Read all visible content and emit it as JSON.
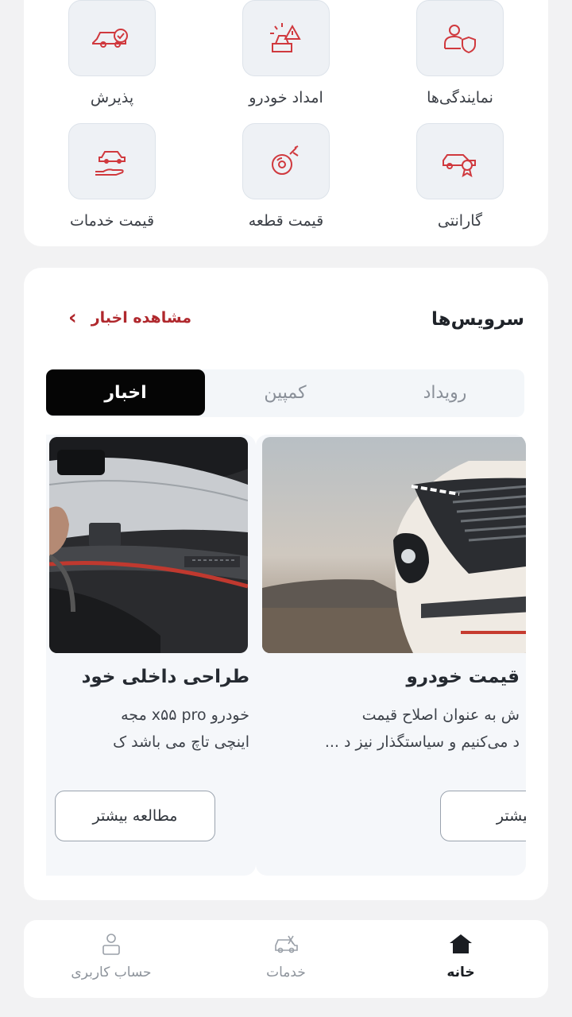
{
  "services": [
    {
      "label": "پذیرش",
      "icon": "car-check-icon"
    },
    {
      "label": "امداد خودرو",
      "icon": "roadside-assist-icon"
    },
    {
      "label": "نمایندگی‌ها",
      "icon": "dealer-shield-icon"
    },
    {
      "label": "قیمت خدمات",
      "icon": "car-hand-icon"
    },
    {
      "label": "قیمت قطعه",
      "icon": "brake-disc-icon"
    },
    {
      "label": "گارانتی",
      "icon": "car-warranty-icon"
    }
  ],
  "news_section": {
    "title": "سرویس‌ها",
    "see_all_label": "مشاهده اخبار",
    "tabs": [
      "رویداد",
      "کمپین",
      "اخبار"
    ],
    "active_tab": "اخبار"
  },
  "cards": [
    {
      "title": "قیمت خودرو",
      "desc_line1": "ش به عنوان اصلاح قیمت",
      "desc_line2": "د می‌کنیم و سیاستگذار نیز د ...",
      "button": "ه بیشتر"
    },
    {
      "title": "طراحی داخلی خود",
      "desc_line1": "خودرو x۵۵ pro مجه",
      "desc_line2": "اینچی تاچ می باشد ک",
      "button": "مطالعه بیشتر"
    }
  ],
  "bottom_nav": [
    {
      "label": "خانه",
      "icon": "home-icon",
      "active": true
    },
    {
      "label": "خدمات",
      "icon": "services-car-icon",
      "active": false
    },
    {
      "label": "حساب کاربری",
      "icon": "user-icon",
      "active": false
    }
  ],
  "colors": {
    "accent": "#b0282d",
    "icon_red": "#d0393e",
    "tab_active": "#050505"
  }
}
